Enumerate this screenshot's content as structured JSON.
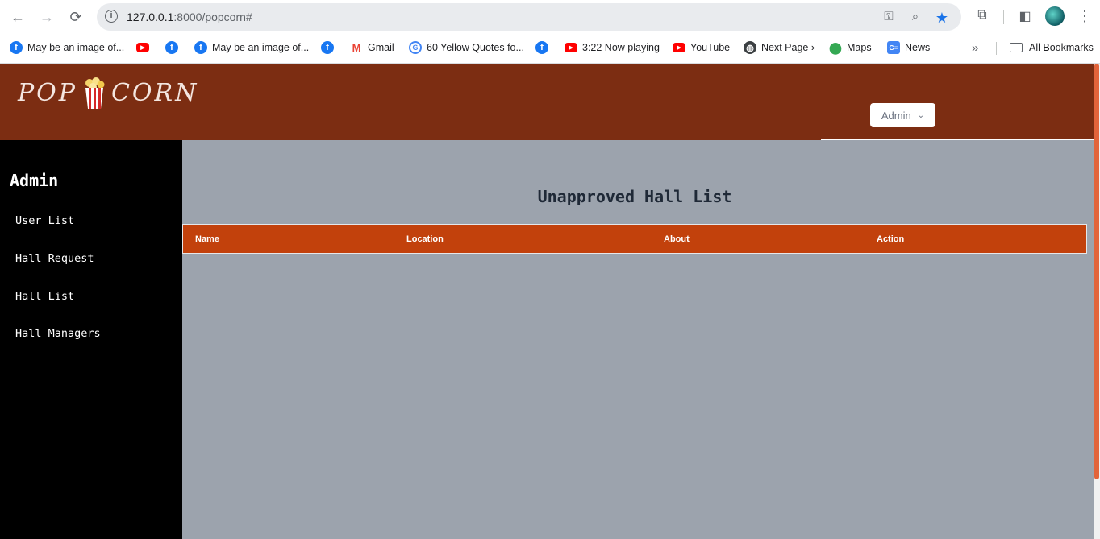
{
  "browser": {
    "url_host": "127.0.0.1",
    "url_rest": ":8000/popcorn#",
    "bookmarks": [
      {
        "icon": "facebook-icon",
        "label": "May be an image of..."
      },
      {
        "icon": "youtube-icon",
        "label": ""
      },
      {
        "icon": "facebook-icon",
        "label": ""
      },
      {
        "icon": "facebook-icon",
        "label": "May be an image of..."
      },
      {
        "icon": "facebook-icon",
        "label": ""
      },
      {
        "icon": "gmail-icon",
        "label": "Gmail"
      },
      {
        "icon": "google-icon",
        "label": "60 Yellow Quotes fo..."
      },
      {
        "icon": "facebook-icon",
        "label": ""
      },
      {
        "icon": "youtube-icon",
        "label": "3:22 Now playing"
      },
      {
        "icon": "youtube-icon",
        "label": "YouTube"
      },
      {
        "icon": "globe-icon",
        "label": "Next Page ›"
      },
      {
        "icon": "maps-icon",
        "label": "Maps"
      },
      {
        "icon": "news-icon",
        "label": "News"
      }
    ],
    "all_bookmarks": "All Bookmarks",
    "more_bookmarks": "»"
  },
  "site": {
    "logo_left": "POP",
    "logo_right": "CORN",
    "admin_dropdown": "Admin"
  },
  "sidebar": {
    "title": "Admin",
    "links": [
      "User List",
      "Hall Request",
      "Hall List",
      "Hall Managers"
    ]
  },
  "main": {
    "title": "Unapproved Hall List",
    "columns": [
      "Name",
      "Location",
      "About",
      "Action"
    ]
  },
  "colors": {
    "header": "#7c2d12",
    "table_header": "#c2410c",
    "main_bg": "#9ca3ad",
    "sidebar_bg": "#000000"
  }
}
